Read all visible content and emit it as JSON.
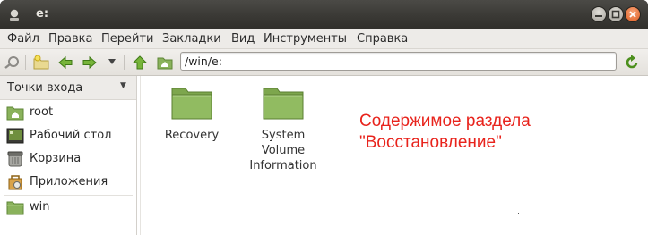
{
  "window": {
    "title": "e:"
  },
  "menu": [
    "Файл",
    "Правка",
    "Перейти",
    "Закладки",
    "Вид",
    "Инструменты",
    "Справка"
  ],
  "toolbar": {
    "address": "/win/e:"
  },
  "sidebar": {
    "header": "Точки входа",
    "items": [
      {
        "label": "root",
        "icon": "home-folder-icon"
      },
      {
        "label": "Рабочий стол",
        "icon": "desktop-icon"
      },
      {
        "label": "Корзина",
        "icon": "trash-icon"
      },
      {
        "label": "Приложения",
        "icon": "applications-icon"
      },
      {
        "label": "win",
        "icon": "folder-icon"
      }
    ]
  },
  "files": [
    {
      "name": "Recovery"
    },
    {
      "name_lines": [
        "System",
        "Volume",
        "Information"
      ]
    }
  ],
  "annotation": {
    "line1": "Содержимое раздела",
    "line2": "\"Восстановление\""
  },
  "colors": {
    "annotation": "#e8231c",
    "folder": "#8ab25c",
    "titlebar": "#3c3b37"
  }
}
